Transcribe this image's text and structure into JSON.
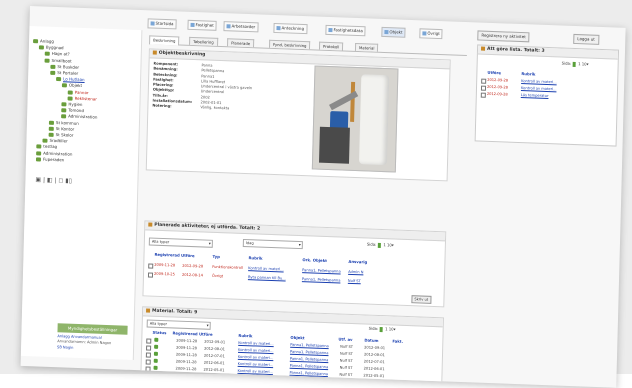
{
  "tree": {
    "items": [
      {
        "label": "Anlagg",
        "type": "normal"
      },
      {
        "label": "Byggnad",
        "type": "normal"
      },
      {
        "label": "Hagn at?",
        "type": "normal"
      },
      {
        "label": "Smallboot",
        "type": "normal"
      },
      {
        "label": "St Buskder",
        "type": "normal"
      },
      {
        "label": "St Portaler",
        "type": "normal"
      },
      {
        "label": "Lo Hutlaan",
        "type": "link"
      },
      {
        "label": "Objekt",
        "type": "normal"
      },
      {
        "label": "Pannor",
        "type": "red"
      },
      {
        "label": "Reklistenar",
        "type": "red"
      },
      {
        "label": "Hygien",
        "type": "normal"
      },
      {
        "label": "Tomond",
        "type": "normal"
      },
      {
        "label": "Administration",
        "type": "normal"
      },
      {
        "label": "St kommun",
        "type": "normal"
      },
      {
        "label": "St Kontor",
        "type": "normal"
      },
      {
        "label": "St Skolor",
        "type": "normal"
      },
      {
        "label": "Sradtiller",
        "type": "normal"
      },
      {
        "label": "testlag",
        "type": "normal"
      },
      {
        "label": "Administration",
        "type": "normal"
      },
      {
        "label": "Fuperaden",
        "type": "normal"
      }
    ],
    "icon_row": "▣ | ◧ | ◻ ▮▯"
  },
  "management": {
    "button": "Myndighetsbeställningar",
    "link": "Anlagg Anvandarmanual",
    "user": "Anvandarnamn: Admin Nagon",
    "logout": "SB Nagin"
  },
  "toolbar": {
    "buttons": [
      {
        "label": "Startsida",
        "active": false
      },
      {
        "label": "Fastighet",
        "active": false
      },
      {
        "label": "Arbetsorder",
        "active": false
      },
      {
        "label": "Anteckning",
        "active": false
      },
      {
        "label": "Fastighetsdata",
        "active": false
      },
      {
        "label": "Objekt",
        "active": true
      },
      {
        "label": "Övrigt",
        "active": false
      }
    ]
  },
  "tabs": [
    "Beskrivning",
    "Tabellering",
    "Planerade",
    "Fynd, beskrivning",
    "Protokoll",
    "Material"
  ],
  "object": {
    "title": "Objektbeskrivning",
    "fields": [
      {
        "k": "Komponent:",
        "v": "Panna"
      },
      {
        "k": "Benämning:",
        "v": "Pelletspanna"
      },
      {
        "k": "Beteckning:",
        "v": "Panna1"
      },
      {
        "k": "Fastighet:",
        "v": "Lilla Hufflaret"
      },
      {
        "k": "Placering:",
        "v": "Undercentral i västra gaveln"
      },
      {
        "k": "Objekttyp:",
        "v": "Undercentral"
      },
      {
        "k": "Tillv.år:",
        "v": "2002"
      },
      {
        "k": "Installationsdatum:",
        "v": "2002-01-01"
      },
      {
        "k": "Notering:",
        "v": "Vänlig, kontakta"
      }
    ]
  },
  "planned": {
    "title": "Planerade aktiviteter, ej utförda. Totalt: 2",
    "filter1": "Alla typer",
    "filter2": "Idag",
    "pager_label": "Sida:",
    "page": "1",
    "per_page": "10",
    "columns": [
      "Registrerad Utföre",
      "Typ",
      "Rubrik",
      "Ork. Objekt",
      "Ansvarig"
    ],
    "rows": [
      [
        "2009-11-28",
        "2012-09-28",
        "Funktionskontroll",
        "Kontroll av materi...",
        "Panna1, Pelletspanna",
        "Admin N"
      ],
      [
        "2009-10-25",
        "2012-08-14",
        "Övrigt",
        "Byta pannan till Bu...",
        "Panna1, Pelletspanna",
        "Nulf ST"
      ]
    ],
    "action": "Skriv ut"
  },
  "material": {
    "title": "Material. Totalt: 9",
    "filter1": "Alla typer",
    "pager_label": "Sida:",
    "page": "1",
    "per_page": "10",
    "columns": [
      "Status",
      "Registrerad Utföre",
      "Rubrik",
      "Objekt",
      "Utf. av",
      "Datum",
      "Fakt."
    ],
    "rows": [
      [
        "2009-11-28",
        "2012-09-01",
        "Kontroll av materi...",
        "Panna1, Pelletspanna",
        "Nulf ST",
        "2012-09-01"
      ],
      [
        "2009-11-28",
        "2012-08-01",
        "Kontroll av materi...",
        "Panna1, Pelletspanna",
        "Nulf ST",
        "2012-08-01"
      ],
      [
        "2009-11-28",
        "2012-07-01",
        "Kontroll av materi...",
        "Panna1, Pelletspanna",
        "Nulf ST",
        "2012-07-01"
      ],
      [
        "2009-11-28",
        "2012-06-01",
        "Kontroll av materi...",
        "Panna1, Pelletspanna",
        "Nulf ST",
        "2012-06-01"
      ],
      [
        "2009-11-28",
        "2012-05-01",
        "Kontroll av materi...",
        "Panna1, Pelletspanna",
        "Nulf ST",
        "2012-05-01"
      ]
    ]
  },
  "right": {
    "btn1": "Registrera ny aktivitet",
    "btn2": "Logga ut",
    "title": "Att göra lista. Totalt: 3",
    "pager_label": "Sida:",
    "page": "1",
    "per_page": "10",
    "columns": [
      "Utföre",
      "Rubrik"
    ],
    "rows": [
      [
        "2012-09-28",
        "Kontroll av materi..."
      ],
      [
        "2012-09-28",
        "Kontroll av materi..."
      ],
      [
        "2012-09-28",
        "Läs temperatur"
      ]
    ]
  }
}
